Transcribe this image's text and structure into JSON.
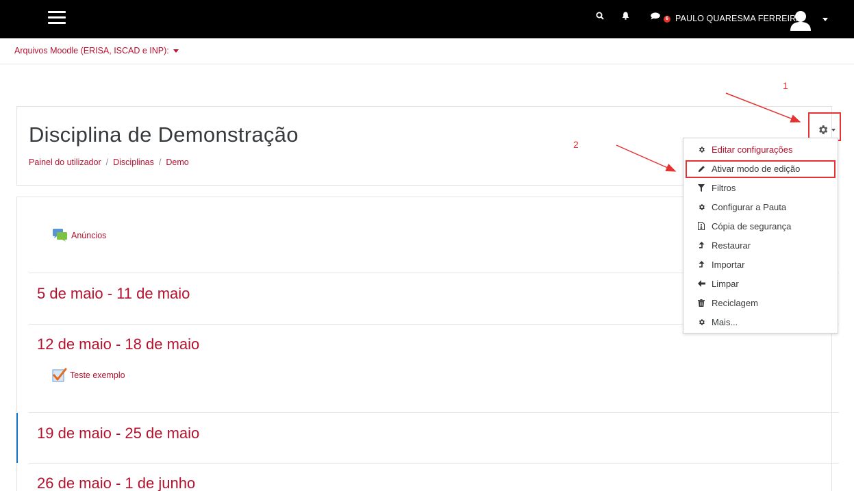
{
  "navbar": {
    "user_name": "PAULO QUARESMA FERREIRA",
    "message_count": "6"
  },
  "subbar": {
    "site_selector": "Arquivos Moodle (ERISA, ISCAD e INP):"
  },
  "course": {
    "title": "Disciplina de Demonstração",
    "breadcrumb": [
      "Painel do utilizador",
      "Disciplinas",
      "Demo"
    ]
  },
  "activities": {
    "announcements": "Anúncios",
    "quiz": "Teste exemplo"
  },
  "sections": [
    "5 de maio - 11 de maio",
    "12 de maio - 18 de maio",
    "19 de maio - 25 de maio",
    "26 de maio - 1 de junho"
  ],
  "menu": {
    "items": [
      {
        "label": "Editar configurações",
        "icon": "gear-icon"
      },
      {
        "label": "Ativar modo de edição",
        "icon": "pencil-icon"
      },
      {
        "label": "Filtros",
        "icon": "filter-icon"
      },
      {
        "label": "Configurar a Pauta",
        "icon": "gear-icon"
      },
      {
        "label": "Cópia de segurança",
        "icon": "file-archive-icon"
      },
      {
        "label": "Restaurar",
        "icon": "level-up-icon"
      },
      {
        "label": "Importar",
        "icon": "level-up-icon"
      },
      {
        "label": "Limpar",
        "icon": "arrow-left-icon"
      },
      {
        "label": "Reciclagem",
        "icon": "trash-icon"
      },
      {
        "label": "Mais...",
        "icon": "gear-icon"
      }
    ]
  },
  "annotations": {
    "step1": "1",
    "step2": "2"
  },
  "colors": {
    "brand": "#b3112d",
    "navbar": "#000000",
    "annotation": "#e53232",
    "current_section": "#0f6fc5"
  }
}
